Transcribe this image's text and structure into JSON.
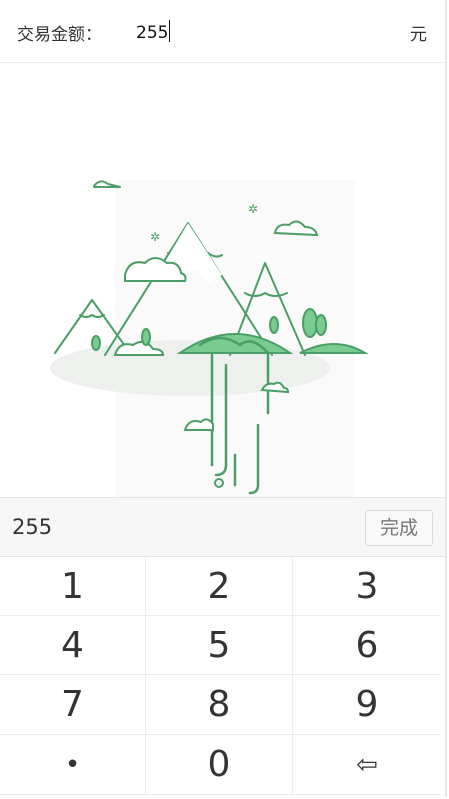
{
  "amount_row": {
    "label": "交易金额：",
    "value": "255",
    "unit": "元"
  },
  "illustration": {
    "icon": "mountain-landscape-illustration",
    "accent_color": "#4caf6e"
  },
  "keyboard": {
    "display_value": "255",
    "done_label": "完成",
    "keys": [
      "1",
      "2",
      "3",
      "4",
      "5",
      "6",
      "7",
      "8",
      "9",
      "•",
      "0",
      "⇦"
    ]
  }
}
